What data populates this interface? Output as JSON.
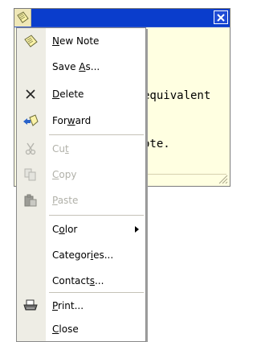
{
  "note": {
    "text_line_1": "equivalent",
    "text_line_2": "ote."
  },
  "menu": {
    "items": [
      {
        "id": "new-note",
        "pre": "",
        "u": "N",
        "post": "ew Note",
        "icon": "note-icon",
        "enabled": true
      },
      {
        "id": "save-as",
        "pre": "Save ",
        "u": "A",
        "post": "s...",
        "icon": "",
        "enabled": true
      },
      {
        "id": "delete",
        "pre": "",
        "u": "D",
        "post": "elete",
        "icon": "delete-x-icon",
        "enabled": true
      },
      {
        "id": "forward",
        "pre": "For",
        "u": "w",
        "post": "ard",
        "icon": "forward-icon",
        "enabled": true
      },
      {
        "id": "cut",
        "pre": "Cu",
        "u": "t",
        "post": "",
        "icon": "scissors-icon",
        "enabled": false
      },
      {
        "id": "copy",
        "pre": "",
        "u": "C",
        "post": "opy",
        "icon": "copy-icon",
        "enabled": false
      },
      {
        "id": "paste",
        "pre": "",
        "u": "P",
        "post": "aste",
        "icon": "paste-icon",
        "enabled": false
      },
      {
        "id": "color",
        "pre": "C",
        "u": "o",
        "post": "lor",
        "icon": "",
        "enabled": true,
        "submenu": true
      },
      {
        "id": "categories",
        "pre": "Categor",
        "u": "i",
        "post": "es...",
        "icon": "",
        "enabled": true
      },
      {
        "id": "contacts",
        "pre": "Contact",
        "u": "s",
        "post": "...",
        "icon": "",
        "enabled": true
      },
      {
        "id": "print",
        "pre": "",
        "u": "P",
        "post": "rint...",
        "icon": "printer-icon",
        "enabled": true
      },
      {
        "id": "close",
        "pre": "",
        "u": "C",
        "post": "lose",
        "icon": "",
        "enabled": true
      }
    ]
  }
}
